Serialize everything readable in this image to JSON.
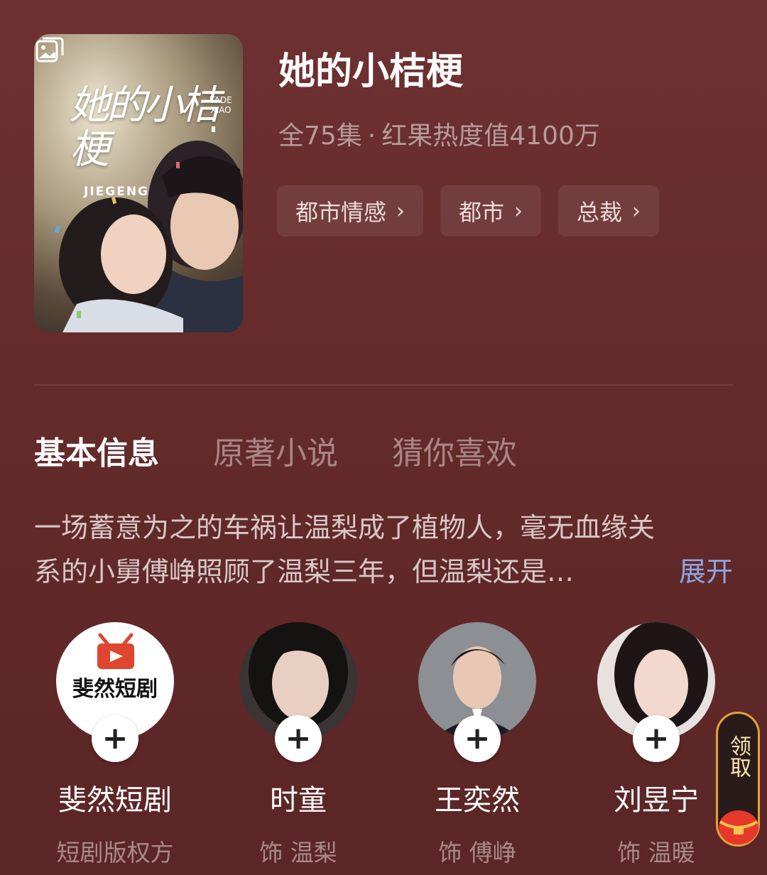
{
  "poster": {
    "title_cn": "她的小桔梗",
    "title_latin": "JIEGENG",
    "sub_latin": "TADE XIAO",
    "gallery_icon": "gallery-icon"
  },
  "drama": {
    "title": "她的小桔梗",
    "episodes": "全75集",
    "separator": "·",
    "heat": "红果热度值4100万"
  },
  "tags": [
    {
      "label": "都市情感"
    },
    {
      "label": "都市"
    },
    {
      "label": "总裁"
    }
  ],
  "tabs": [
    {
      "label": "基本信息",
      "active": true
    },
    {
      "label": "原著小说",
      "active": false
    },
    {
      "label": "猜你喜欢",
      "active": false
    }
  ],
  "synopsis": {
    "line1": "一场蓄意为之的车祸让温梨成了植物人，毫无血缘关",
    "line2": "系的小舅傅峥照顾了温梨三年，但温梨还是…",
    "expand_label": "展开"
  },
  "people": [
    {
      "name": "斐然短剧",
      "role": "短剧版权方",
      "avatar_text": "斐然短剧",
      "follow": "+"
    },
    {
      "name": "时童",
      "role": "饰 温梨",
      "follow": "+"
    },
    {
      "name": "王奕然",
      "role": "饰 傅峥",
      "follow": "+"
    },
    {
      "name": "刘昱宁",
      "role": "饰 温暖",
      "follow": "+"
    }
  ],
  "reward": {
    "label": "领取"
  },
  "colors": {
    "background": "#652b2b",
    "accent_link": "#8fa6e6",
    "muted_text": "#b79b9b",
    "reward_border": "#e3a23a"
  }
}
